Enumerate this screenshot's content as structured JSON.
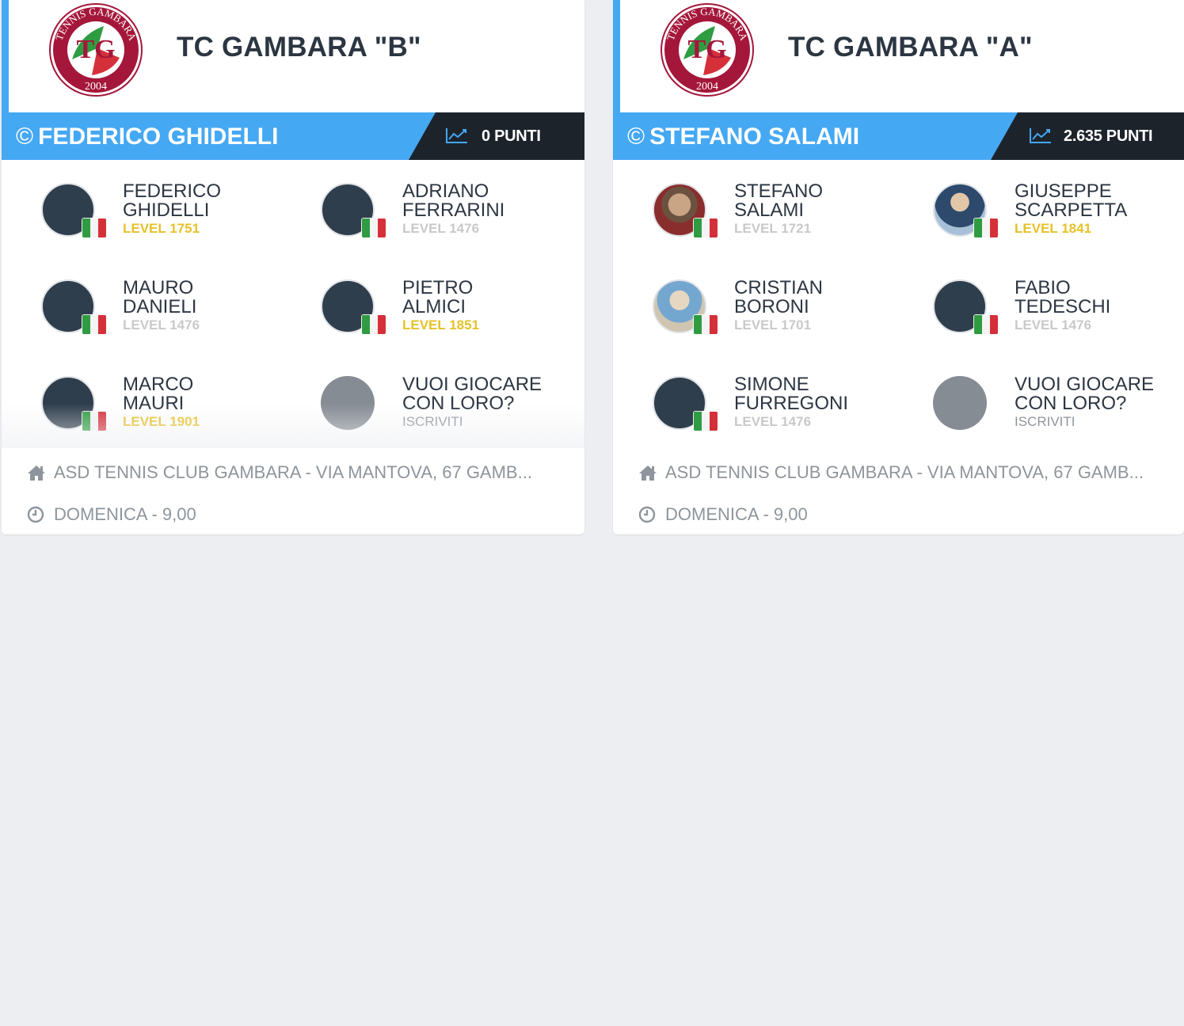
{
  "teams": [
    {
      "name": "TC GAMBARA \"B\"",
      "captain": "FEDERICO GHIDELLI",
      "copyright_symbol": "©",
      "points": "0 PUNTI",
      "logo": {
        "top": "TENNIS GAMBARA",
        "year": "2004",
        "initials": "TG"
      },
      "players": [
        {
          "name": "FEDERICO\nGHIDELLI",
          "level": "LEVEL 1751",
          "level_color": "gold",
          "avatar": "default"
        },
        {
          "name": "ADRIANO\nFERRARINI",
          "level": "LEVEL 1476",
          "level_color": "grey",
          "avatar": "default"
        },
        {
          "name": "MAURO\nDANIELI",
          "level": "LEVEL 1476",
          "level_color": "grey",
          "avatar": "default"
        },
        {
          "name": "PIETRO\nALMICI",
          "level": "LEVEL 1851",
          "level_color": "gold",
          "avatar": "default"
        },
        {
          "name": "MARCO\nMAURI",
          "level": "LEVEL 1901",
          "level_color": "gold",
          "avatar": "default"
        },
        {
          "name": "VUOI GIOCARE\nCON LORO?",
          "level": "ISCRIVITI",
          "level_color": "sub",
          "avatar": "empty"
        }
      ],
      "address": "ASD TENNIS CLUB GAMBARA - VIA MANTOVA, 67 GAMB...",
      "schedule": "DOMENICA - 9,00"
    },
    {
      "name": "TC GAMBARA \"A\"",
      "captain": "STEFANO SALAMI",
      "copyright_symbol": "©",
      "points": "2.635 PUNTI",
      "logo": {
        "top": "TENNIS GAMBARA",
        "year": "2004",
        "initials": "TG"
      },
      "players": [
        {
          "name": "STEFANO\nSALAMI",
          "level": "LEVEL 1721",
          "level_color": "grey",
          "avatar": "photo1"
        },
        {
          "name": "GIUSEPPE\nSCARPETTA",
          "level": "LEVEL 1841",
          "level_color": "gold",
          "avatar": "photo2"
        },
        {
          "name": "CRISTIAN\nBORONI",
          "level": "LEVEL 1701",
          "level_color": "grey",
          "avatar": "photo3"
        },
        {
          "name": "FABIO\nTEDESCHI",
          "level": "LEVEL 1476",
          "level_color": "grey",
          "avatar": "default"
        },
        {
          "name": "SIMONE\nFURREGONI",
          "level": "LEVEL 1476",
          "level_color": "grey",
          "avatar": "default"
        },
        {
          "name": "VUOI GIOCARE\nCON LORO?",
          "level": "ISCRIVITI",
          "level_color": "sub",
          "avatar": "empty"
        }
      ],
      "address": "ASD TENNIS CLUB GAMBARA - VIA MANTOVA, 67 GAMB...",
      "schedule": "DOMENICA - 9,00"
    }
  ],
  "icons": {
    "chart": "chart-line-icon",
    "home": "home-icon",
    "clock": "clock-icon",
    "flag": "italy-flag-icon"
  },
  "colors": {
    "accent_blue": "#45a8f3",
    "dark_bar": "#1c232b",
    "gold_level": "#e6c229",
    "grey_level": "#c9c9c9",
    "background": "#edeef2"
  }
}
